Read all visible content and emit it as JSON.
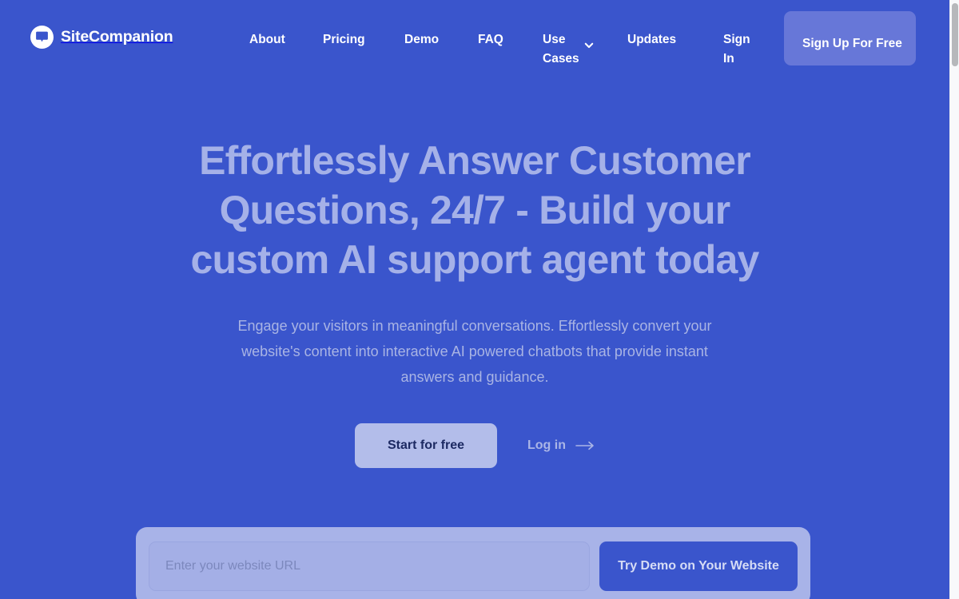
{
  "brand": {
    "name": "SiteCompanion",
    "logo_icon": "chat-bubble-icon"
  },
  "nav": {
    "items": [
      {
        "id": "about",
        "label": "About"
      },
      {
        "id": "pricing",
        "label": "Pricing"
      },
      {
        "id": "demo",
        "label": "Demo"
      },
      {
        "id": "faq",
        "label": "FAQ"
      },
      {
        "id": "usecases",
        "label": "Use Cases",
        "has_dropdown": true,
        "dropdown_icon": "chevron-down-icon"
      },
      {
        "id": "updates",
        "label": "Updates"
      },
      {
        "id": "signin",
        "label": "Sign In"
      }
    ],
    "signup_label": "Sign Up For Free"
  },
  "hero": {
    "title": "Effortlessly Answer Customer Questions, 24/7 - Build your custom AI support agent today",
    "subtitle": "Engage your visitors in meaningful conversations. Effortlessly convert your website's content into interactive AI powered chatbots that provide instant answers and guidance.",
    "primary_cta": "Start for free",
    "secondary_cta": "Log in",
    "secondary_cta_icon": "arrow-right-icon"
  },
  "demo_form": {
    "input_placeholder": "Enter your website URL",
    "input_value": "",
    "submit_label": "Try Demo on Your Website"
  },
  "colors": {
    "background": "#3a55cc",
    "heading": "#a5b1e8",
    "body_text": "#a9b4e4",
    "signup_button": "#6777d8",
    "primary_button": "#b3bdea",
    "primary_button_text": "#1d2a63",
    "card": "#a8b3e8",
    "demo_button": "#3a55cc"
  },
  "scrollbar": {
    "visible": true,
    "thumb_position": "top"
  }
}
